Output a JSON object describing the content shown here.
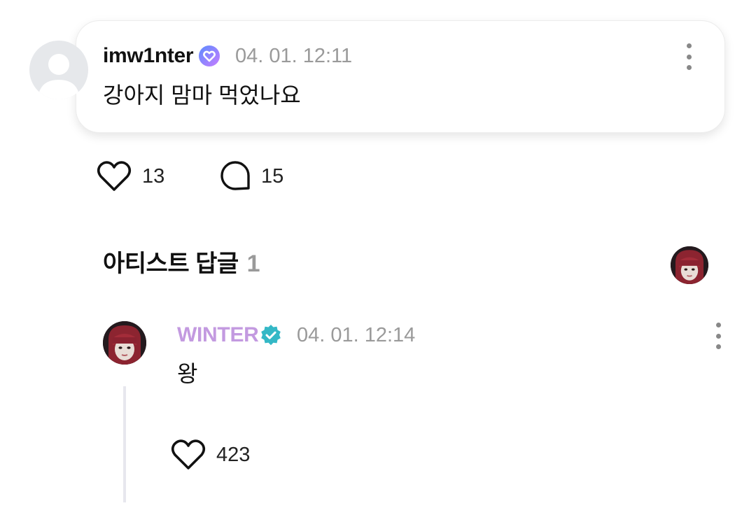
{
  "comment": {
    "username": "imw1nter",
    "timestamp": "04. 01. 12:11",
    "text": "강아지 맘마 먹었나요",
    "like_count": "13",
    "reply_count": "15"
  },
  "artist_section": {
    "title": "아티스트 답글",
    "count": "1"
  },
  "artist_reply": {
    "username": "WINTER",
    "timestamp": "04. 01. 12:14",
    "text": "왕",
    "like_count": "423"
  },
  "colors": {
    "artist_name": "#c39ae0",
    "verified_badge": "#34b8c6",
    "fan_badge_start": "#5b8cff",
    "fan_badge_end": "#c77dff",
    "muted_text": "#9a9a9a"
  },
  "icons": {
    "menu": "more-vertical-icon",
    "like": "heart-icon",
    "reply": "comment-bubble-icon",
    "fan_badge": "heart-badge-icon",
    "artist_badge": "verified-check-icon"
  }
}
